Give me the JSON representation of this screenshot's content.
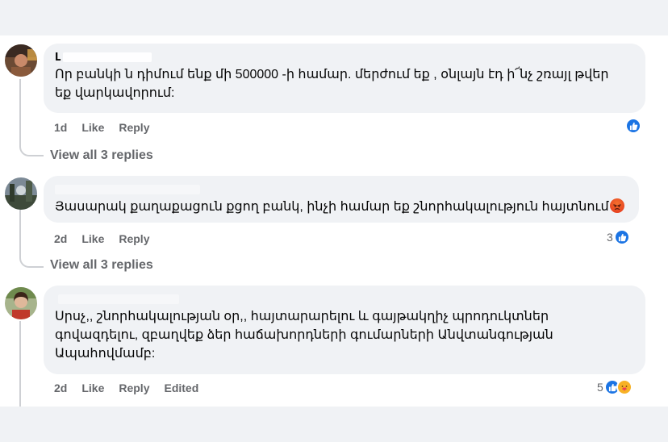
{
  "comments": [
    {
      "author": "Լ",
      "text_lines": [
        "Որ բանկի ն դիմում ենք մի 500000 -ի համար. մերժում եք , օնլայն էդ ի՜նչ շռայլ թվեր",
        "եք վարկավորում:"
      ],
      "time": "1d",
      "like_label": "Like",
      "reply_label": "Reply",
      "reaction_count": "",
      "reaction_icons": [
        "like-icon"
      ],
      "view_replies": "View all 3 replies"
    },
    {
      "author": "",
      "text_lines": [
        "Յասարակ քաղաքացուն քցող բանկ, ինչի համար եք շնորհակալություն հայտնում"
      ],
      "time": "2d",
      "like_label": "Like",
      "reply_label": "Reply",
      "reaction_count": "3",
      "reaction_icons": [
        "like-icon"
      ],
      "view_replies": "View all 3 replies"
    },
    {
      "author": "",
      "text_lines": [
        "Սրսչ,, շնորհակալության օր,, հայտարարելու և գայթակղիչ պրոդուկտներ",
        "գովազդելու, զբաղվեք ձեր հաճախորդների գումարների Անվտանգության",
        "Ապահովմամբ:"
      ],
      "time": "2d",
      "like_label": "Like",
      "reply_label": "Reply",
      "edited_label": "Edited",
      "reaction_count": "5",
      "reaction_icons": [
        "like-icon",
        "care-icon"
      ]
    }
  ],
  "colors": {
    "page_bg": "#f0f2f5",
    "card_bg": "#ffffff",
    "bubble_bg": "#f0f2f5",
    "text": "#050505",
    "secondary": "#65676b",
    "like_blue": "#1b74e4",
    "care_yellow": "#f7b125"
  }
}
